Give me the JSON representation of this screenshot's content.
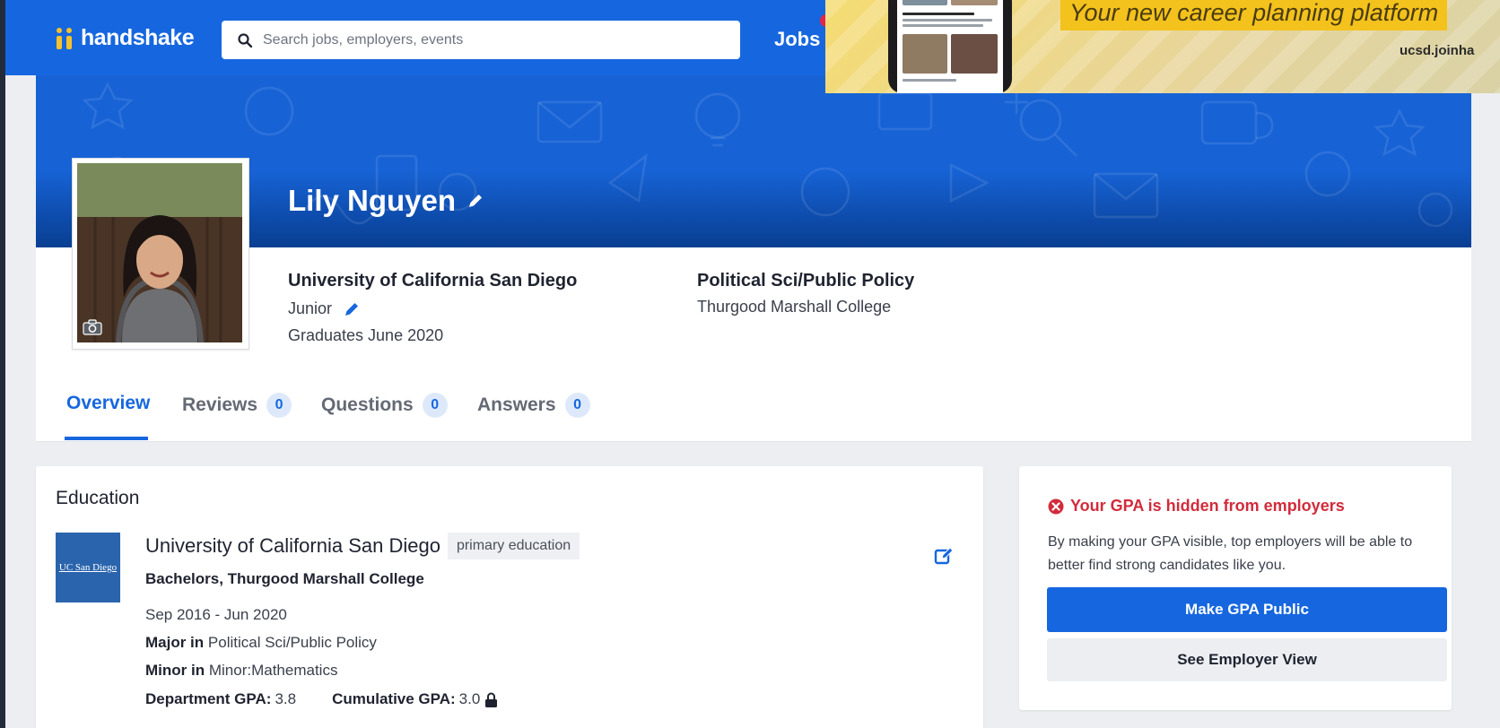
{
  "nav": {
    "brand": "handshake",
    "search_placeholder": "Search jobs, employers, events",
    "jobs_label": "Jobs"
  },
  "ad_banner": {
    "slogan": "Your new career planning platform",
    "url": "ucsd.joinha"
  },
  "profile": {
    "name": "Lily Nguyen",
    "school": "University of California San Diego",
    "year": "Junior",
    "graduation": "Graduates June 2020",
    "major": "Political Sci/Public Policy",
    "college": "Thurgood Marshall College"
  },
  "tabs": [
    {
      "label": "Overview"
    },
    {
      "label": "Reviews",
      "count": "0"
    },
    {
      "label": "Questions",
      "count": "0"
    },
    {
      "label": "Answers",
      "count": "0"
    }
  ],
  "education": {
    "title": "Education",
    "logo_text": "UC San Diego",
    "school": "University of California San Diego",
    "tag": "primary education",
    "degree": "Bachelors, Thurgood Marshall College",
    "dates": "Sep 2016 - Jun 2020",
    "major_label": "Major in",
    "major_value": "Political Sci/Public Policy",
    "minor_label": "Minor in",
    "minor_value": "Minor:Mathematics",
    "dept_gpa_label": "Department GPA:",
    "dept_gpa_value": "3.8",
    "cum_gpa_label": "Cumulative GPA:",
    "cum_gpa_value": "3.0"
  },
  "gpa_card": {
    "warning": "Your GPA is hidden from employers",
    "description": "By making your GPA visible, top employers will be able to better find strong candidates like you.",
    "primary_button": "Make GPA Public",
    "secondary_button": "See Employer View"
  },
  "colors": {
    "brand_blue": "#1667df",
    "warning_red": "#d12c3c",
    "logo_yellow": "#f6c12b",
    "banner_yellow": "#f3c21c"
  }
}
